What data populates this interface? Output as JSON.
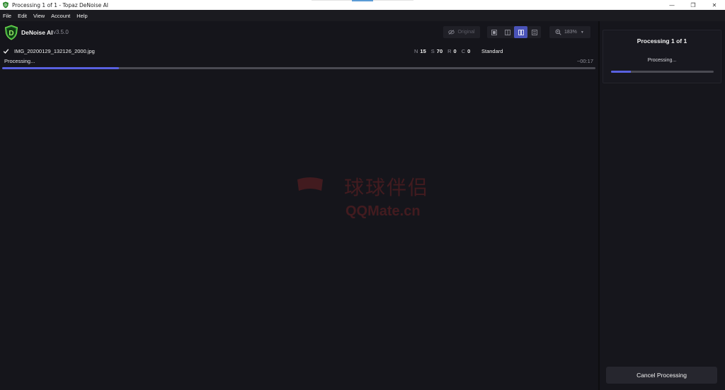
{
  "window": {
    "title": "Processing 1 of 1 - Topaz DeNoise AI",
    "controls": {
      "minimize": "—",
      "restore": "❐",
      "close": "✕"
    }
  },
  "menu": {
    "items": [
      "File",
      "Edit",
      "View",
      "Account",
      "Help"
    ]
  },
  "header": {
    "app_name": "DeNoise AI",
    "version": "v3.5.0",
    "logo_letter": "D",
    "original_label": "Original",
    "zoom": "183%"
  },
  "file": {
    "name": "IMG_20200129_132126_2000.jpg",
    "params": [
      {
        "key": "N",
        "value": "15"
      },
      {
        "key": "S",
        "value": "70"
      },
      {
        "key": "R",
        "value": "0"
      },
      {
        "key": "C",
        "value": "0"
      }
    ],
    "model": "Standard",
    "status": "Processing...",
    "eta": "~00:17",
    "progress": 0.197
  },
  "watermark": {
    "cn": "球球伴侣",
    "en": "QQMate.cn"
  },
  "side_panel": {
    "title": "Processing 1 of 1",
    "status": "Processing...",
    "progress": 0.19,
    "cancel_label": "Cancel Processing"
  },
  "colors": {
    "accent": "#5961e0",
    "background": "#15151b",
    "watermark": "#e03030"
  }
}
